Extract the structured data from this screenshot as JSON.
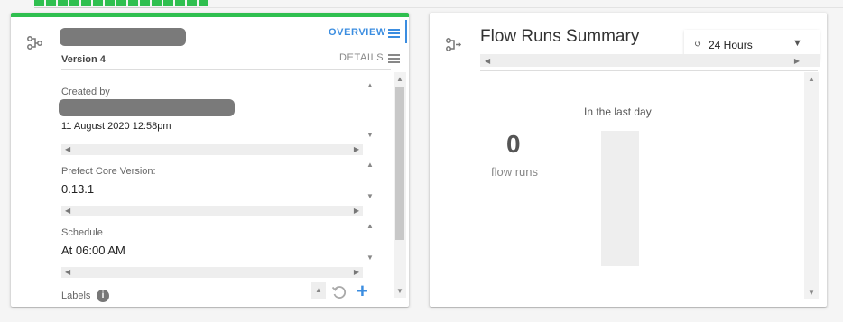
{
  "topbar": {
    "progress_segments": 15
  },
  "flow_card": {
    "tabs": {
      "overview": "OVERVIEW",
      "details": "DETAILS"
    },
    "version": "Version 4",
    "created_by_label": "Created by",
    "created_date": "11 August 2020 12:58pm",
    "core_version_label": "Prefect Core Version:",
    "core_version": "0.13.1",
    "schedule_label": "Schedule",
    "schedule": "At 06:00 AM",
    "labels_label": "Labels",
    "info_icon_text": "i",
    "add_icon_text": "+",
    "colors": {
      "accent": "#2fbf4f",
      "link": "#3b8de0"
    }
  },
  "summary_card": {
    "title": "Flow Runs Summary",
    "time_range": "24 Hours",
    "period_label": "In the last day",
    "count": "0",
    "count_label": "flow runs"
  }
}
